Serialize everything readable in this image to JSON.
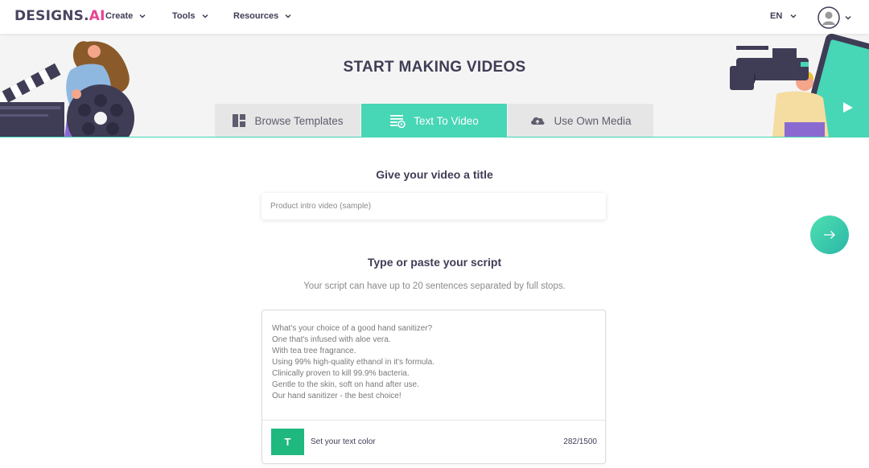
{
  "nav": {
    "logo_main": "DESIGNS.",
    "logo_ai": "AI",
    "menu": [
      {
        "label": "Create"
      },
      {
        "label": "Tools"
      },
      {
        "label": "Resources"
      }
    ],
    "language": "EN"
  },
  "hero": {
    "title": "START MAKING VIDEOS",
    "tabs": [
      {
        "label": "Browse Templates",
        "icon": "template-grid-icon",
        "active": false
      },
      {
        "label": "Text To Video",
        "icon": "text-to-video-icon",
        "active": true
      },
      {
        "label": "Use Own Media",
        "icon": "cloud-upload-icon",
        "active": false
      }
    ]
  },
  "title_section": {
    "heading": "Give your video a title",
    "placeholder": "Product intro video (sample)"
  },
  "script_section": {
    "heading": "Type or paste your script",
    "subtext": "Your script can have up to 20 sentences separated by full stops.",
    "lines": [
      "What's your choice of a good hand sanitizer?",
      "One that's infused with aloe vera.",
      "With tea tree fragrance.",
      "Using 99% high-quality ethanol in it's formula.",
      "Clinically proven to kill 99.9% bacteria.",
      "Gentle to the skin, soft on hand after use.",
      "Our hand sanitizer - the best choice!"
    ],
    "color_button": "T",
    "color_label": "Set your text color",
    "char_count": "282/1500"
  },
  "colors": {
    "accent": "#47d6b6",
    "text_color_swatch": "#1fb87e",
    "heading": "#3f3d56"
  }
}
